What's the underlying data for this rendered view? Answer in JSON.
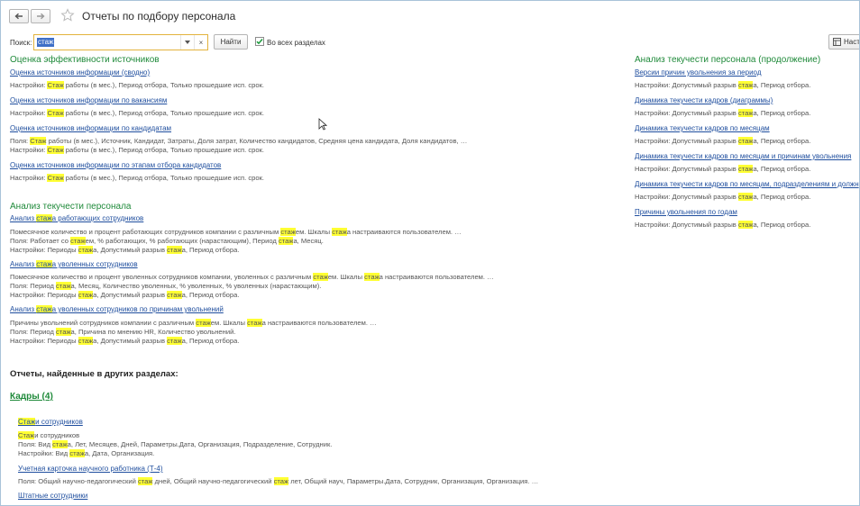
{
  "header": {
    "title": "Отчеты по подбору персонала",
    "back_icon": "arrow-left-icon",
    "forward_icon": "arrow-right-icon",
    "favorite_icon": "star-icon"
  },
  "search": {
    "label": "Поиск:",
    "value": "стаж",
    "clear": "×",
    "find_label": "Найти",
    "all_sections_label": "Во всех разделах",
    "all_sections_checked": true,
    "settings_label": "Наст"
  },
  "left_sections": [
    {
      "title": "Оценка эффективности источников",
      "items": [
        {
          "link": "Оценка источников информации (сводно)",
          "lines": [
            [
              {
                "t": "Настройки: "
              },
              {
                "t": "Стаж",
                "h": true
              },
              {
                "t": " работы (в мес.), Период отбора, Только прошедшие исп. срок."
              }
            ]
          ]
        },
        {
          "link": "Оценка источников информации по вакансиям",
          "lines": [
            [
              {
                "t": "Настройки: "
              },
              {
                "t": "Стаж",
                "h": true
              },
              {
                "t": " работы (в мес.), Период отбора, Только прошедшие исп. срок."
              }
            ]
          ]
        },
        {
          "link": "Оценка источников информации по кандидатам",
          "lines": [
            [
              {
                "t": "Поля: "
              },
              {
                "t": "Стаж",
                "h": true
              },
              {
                "t": " работы (в мес.), Источник, Кандидат, Затраты, Доля затрат, Количество кандидатов, Средняя цена кандидата, Доля кандидатов, …"
              }
            ],
            [
              {
                "t": "Настройки: "
              },
              {
                "t": "Стаж",
                "h": true
              },
              {
                "t": " работы (в мес.), Период отбора, Только прошедшие исп. срок."
              }
            ]
          ]
        },
        {
          "link": "Оценка источников информации по этапам отбора кандидатов",
          "lines": [
            [
              {
                "t": "Настройки: "
              },
              {
                "t": "Стаж",
                "h": true
              },
              {
                "t": " работы (в мес.), Период отбора, Только прошедшие исп. срок."
              }
            ]
          ]
        }
      ]
    },
    {
      "title": "Анализ текучести персонала",
      "items": [
        {
          "link": [
            {
              "t": "Анализ "
            },
            {
              "t": "стаж",
              "h": true
            },
            {
              "t": "а работающих сотрудников"
            }
          ],
          "lines": [
            [
              {
                "t": "Помесячное количество и процент работающих сотрудников компании с различным "
              },
              {
                "t": "стаж",
                "h": true
              },
              {
                "t": "ем. Шкалы "
              },
              {
                "t": "стаж",
                "h": true
              },
              {
                "t": "а настраиваются пользователем. …"
              }
            ],
            [
              {
                "t": "Поля: Работает со "
              },
              {
                "t": "стаж",
                "h": true
              },
              {
                "t": "ем, % работающих, % работающих (нарастающим), Период "
              },
              {
                "t": "стаж",
                "h": true
              },
              {
                "t": "а, Месяц."
              }
            ],
            [
              {
                "t": "Настройки: Периоды "
              },
              {
                "t": "стаж",
                "h": true
              },
              {
                "t": "а, Допустимый разрыв "
              },
              {
                "t": "стаж",
                "h": true
              },
              {
                "t": "а, Период отбора."
              }
            ]
          ]
        },
        {
          "link": [
            {
              "t": "Анализ "
            },
            {
              "t": "стаж",
              "h": true
            },
            {
              "t": "а уволенных сотрудников"
            }
          ],
          "lines": [
            [
              {
                "t": "Помесячное количество и процент уволенных сотрудников компании, уволенных с различным "
              },
              {
                "t": "стаж",
                "h": true
              },
              {
                "t": "ем. Шкалы "
              },
              {
                "t": "стаж",
                "h": true
              },
              {
                "t": "а настраиваются пользователем. …"
              }
            ],
            [
              {
                "t": "Поля: Период "
              },
              {
                "t": "стаж",
                "h": true
              },
              {
                "t": "а, Месяц, Количество уволенных, % уволенных, % уволенных (нарастающим)."
              }
            ],
            [
              {
                "t": "Настройки: Периоды "
              },
              {
                "t": "стаж",
                "h": true
              },
              {
                "t": "а, Допустимый разрыв "
              },
              {
                "t": "стаж",
                "h": true
              },
              {
                "t": "а, Период отбора."
              }
            ]
          ]
        },
        {
          "link": [
            {
              "t": "Анализ "
            },
            {
              "t": "стаж",
              "h": true
            },
            {
              "t": "а уволенных сотрудников по причинам увольнений"
            }
          ],
          "lines": [
            [
              {
                "t": "Причины увольнений сотрудников компании с различным "
              },
              {
                "t": "стаж",
                "h": true
              },
              {
                "t": "ем. Шкалы "
              },
              {
                "t": "стаж",
                "h": true
              },
              {
                "t": "а настраиваются пользователем. …"
              }
            ],
            [
              {
                "t": "Поля: Период "
              },
              {
                "t": "стаж",
                "h": true
              },
              {
                "t": "а, Причина по мнению HR, Количество увольнений."
              }
            ],
            [
              {
                "t": "Настройки: Периоды "
              },
              {
                "t": "стаж",
                "h": true
              },
              {
                "t": "а, Допустимый разрыв "
              },
              {
                "t": "стаж",
                "h": true
              },
              {
                "t": "а, Период отбора."
              }
            ]
          ]
        }
      ]
    }
  ],
  "right_section": {
    "title": "Анализ текучести персонала (продолжение)",
    "items": [
      {
        "link": "Версии причин увольнения за период",
        "lines": [
          [
            {
              "t": "Настройки: Допустимый разрыв "
            },
            {
              "t": "стаж",
              "h": true
            },
            {
              "t": "а, Период отбора."
            }
          ]
        ]
      },
      {
        "link": "Динамика текучести кадров (диаграммы)",
        "lines": [
          [
            {
              "t": "Настройки: Допустимый разрыв "
            },
            {
              "t": "стаж",
              "h": true
            },
            {
              "t": "а, Период отбора."
            }
          ]
        ]
      },
      {
        "link": "Динамика текучести кадров по месяцам",
        "lines": [
          [
            {
              "t": "Настройки: Допустимый разрыв "
            },
            {
              "t": "стаж",
              "h": true
            },
            {
              "t": "а, Период отбора."
            }
          ]
        ]
      },
      {
        "link": "Динамика текучести кадров по месяцам и причинам увольнения",
        "lines": [
          [
            {
              "t": "Настройки: Допустимый разрыв "
            },
            {
              "t": "стаж",
              "h": true
            },
            {
              "t": "а, Период отбора."
            }
          ]
        ]
      },
      {
        "link": "Динамика текучести кадров по месяцам, подразделениям и должн",
        "lines": [
          [
            {
              "t": "Настройки: Допустимый разрыв "
            },
            {
              "t": "стаж",
              "h": true
            },
            {
              "t": "а, Период отбора."
            }
          ]
        ]
      },
      {
        "link": "Причины увольнения по годам",
        "lines": [
          [
            {
              "t": "Настройки: Допустимый разрыв "
            },
            {
              "t": "стаж",
              "h": true
            },
            {
              "t": "а, Период отбора."
            }
          ]
        ]
      }
    ]
  },
  "other_sections": {
    "title": "Отчеты, найденные в других разделах:",
    "group_title": "Кадры (4)",
    "items": [
      {
        "link": [
          {
            "t": "Стаж",
            "h": true
          },
          {
            "t": "и сотрудников"
          }
        ],
        "lines": [
          [
            {
              "t": "Стаж",
              "h": true
            },
            {
              "t": "и сотрудников"
            }
          ],
          [
            {
              "t": "Поля: Вид "
            },
            {
              "t": "стаж",
              "h": true
            },
            {
              "t": "а, Лет, Месяцев, Дней, Параметры.Дата, Организация, Подразделение, Сотрудник."
            }
          ],
          [
            {
              "t": "Настройки: Вид "
            },
            {
              "t": "стаж",
              "h": true
            },
            {
              "t": "а, Дата, Организация."
            }
          ]
        ]
      },
      {
        "link": "Учетная карточка научного работника (Т-4)",
        "lines": [
          [
            {
              "t": "Поля: Общий научно-педагогический "
            },
            {
              "t": "стаж",
              "h": true
            },
            {
              "t": " дней, Общий научно-педагогический "
            },
            {
              "t": "стаж",
              "h": true
            },
            {
              "t": " лет, Общий науч, Параметры.Дата, Сотрудник, Организация, Организация. …"
            }
          ]
        ]
      },
      {
        "link": "Штатные сотрудники",
        "lines": []
      }
    ]
  }
}
